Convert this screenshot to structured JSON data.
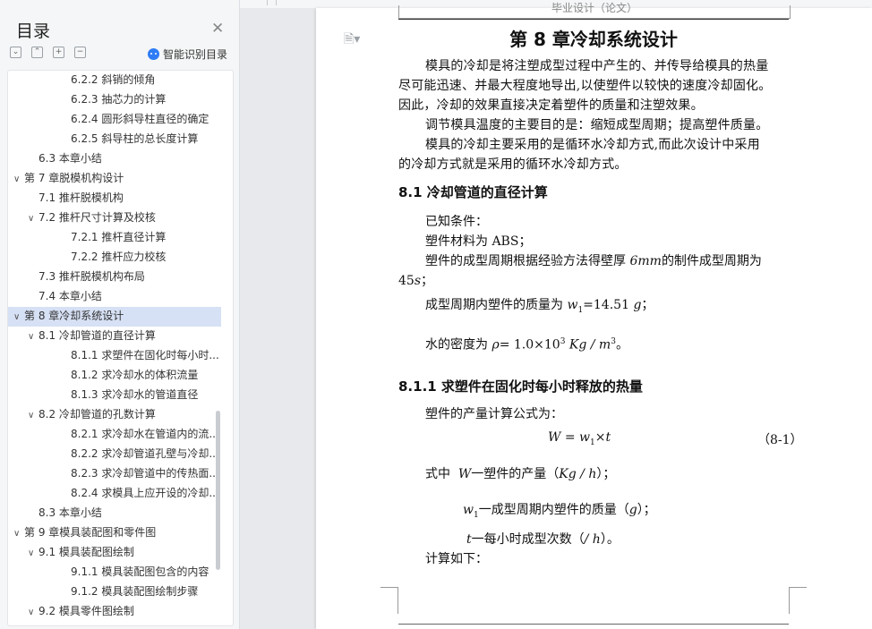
{
  "sidebar": {
    "title": "目录",
    "ai_label": "智能识别目录",
    "toc": [
      {
        "label": "6.2.2  斜销的倾角",
        "level": 3
      },
      {
        "label": "6.2.3  抽芯力的计算",
        "level": 3
      },
      {
        "label": "6.2.4  圆形斜导柱直径的确定",
        "level": 3
      },
      {
        "label": "6.2.5  斜导柱的总长度计算",
        "level": 3
      },
      {
        "label": "6.3  本章小结",
        "level": 2
      },
      {
        "label": "第 7 章脱模机构设计",
        "level": 1,
        "caret": "∨"
      },
      {
        "label": "7.1  推杆脱模机构",
        "level": 2
      },
      {
        "label": "7.2  推杆尺寸计算及校核",
        "level": 2,
        "caret": "∨"
      },
      {
        "label": "7.2.1  推杆直径计算",
        "level": 3
      },
      {
        "label": "7.2.2  推杆应力校核",
        "level": 3
      },
      {
        "label": "7.3  推杆脱模机构布局",
        "level": 2
      },
      {
        "label": "7.4  本章小结",
        "level": 2
      },
      {
        "label": "第 8 章冷却系统设计",
        "level": 1,
        "caret": "∨",
        "active": true
      },
      {
        "label": "8.1  冷却管道的直径计算",
        "level": 2,
        "caret": "∨"
      },
      {
        "label": "8.1.1  求塑件在固化时每小时...",
        "level": 3
      },
      {
        "label": "8.1.2  求冷却水的体积流量",
        "level": 3
      },
      {
        "label": "8.1.3  求冷却水的管道直径",
        "level": 3
      },
      {
        "label": "8.2  冷却管道的孔数计算",
        "level": 2,
        "caret": "∨"
      },
      {
        "label": "8.2.1  求冷却水在管道内的流...",
        "level": 3
      },
      {
        "label": "8.2.2  求冷却管道孔壁与冷却...",
        "level": 3
      },
      {
        "label": "8.2.3  求冷却管道中的传热面...",
        "level": 3
      },
      {
        "label": "8.2.4  求模具上应开设的冷却...",
        "level": 3
      },
      {
        "label": "8.3  本章小结",
        "level": 2
      },
      {
        "label": "第 9 章模具装配图和零件图",
        "level": 1,
        "caret": "∨"
      },
      {
        "label": "9.1  模具装配图绘制",
        "level": 2,
        "caret": "∨"
      },
      {
        "label": "9.1.1  模具装配图包含的内容",
        "level": 3
      },
      {
        "label": "9.1.2  模具装配图绘制步骤",
        "level": 3
      },
      {
        "label": "9.2  模具零件图绘制",
        "level": 2,
        "caret": "∨"
      }
    ]
  },
  "document": {
    "header": "毕业设计（论文）",
    "title": "第 8 章冷却系统设计",
    "para1": [
      "模具的冷却是将注塑成型过程中产生的、并传导给模具的热量",
      "尽可能迅速、并最大程度地导出,以使塑件以较快的速度冷却固化。",
      "因此，冷却的效果直接决定着塑件的质量和注塑效果。"
    ],
    "para2": "调节模具温度的主要目的是：缩短成型周期；提高塑件质量。",
    "para3": [
      "模具的冷却主要采用的是循环水冷却方式,而此次设计中采用",
      "的冷却方式就是采用的循环水冷却方式。"
    ],
    "h2": "8.1  冷却管道的直径计算",
    "known": "已知条件：",
    "material": "塑件材料为 ABS；",
    "cycle_a": "塑件的成型周期根据经验方法得壁厚",
    "cycle_wall": "6",
    "cycle_wall_unit": "mm",
    "cycle_b": "的制件成型周期为",
    "cycle_val": "45",
    "cycle_unit": "s",
    "cycle_end": "；",
    "mass_text": "成型周期内塑件的质量为",
    "mass_var": "w",
    "mass_sub": "1",
    "mass_val": "=14.51",
    "mass_unit": "g",
    "mass_end": "；",
    "density_text": "水的密度为",
    "density_var": "ρ",
    "density_val": "= 1.0×10",
    "density_exp": "3",
    "density_unit": "Kg / m",
    "density_unit_exp": "3",
    "density_end": "。",
    "h3": "8.1.1  求塑件在固化时每小时释放的热量",
    "prod_text": "塑件的产量计算公式为：",
    "formula": "W = w",
    "formula_sub": "1",
    "formula_tail": "×t",
    "eq_num": "（8-1）",
    "where_a": "式中",
    "where_var": "W",
    "where_b": "一塑件的产量（",
    "where_unit": "Kg / h",
    "where_c": "）；",
    "w1_var": "w",
    "w1_sub": "1",
    "w1_text": "一成型周期内塑件的质量（",
    "w1_unit": "g",
    "w1_end": "）；",
    "t_var": "t",
    "t_text": "一每小时成型次数（",
    "t_unit": "/ h",
    "t_end": "）。",
    "calc": "计算如下："
  }
}
